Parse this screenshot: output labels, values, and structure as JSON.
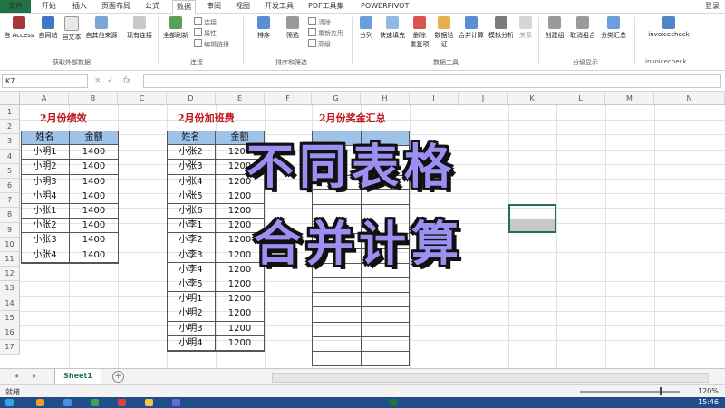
{
  "tabs": [
    "文件",
    "开始",
    "插入",
    "页面布局",
    "公式",
    "数据",
    "审阅",
    "视图",
    "开发工具",
    "PDF工具集",
    "POWERPIVOT"
  ],
  "active_tab": "数据",
  "login_label": "登录",
  "ribbon": {
    "external": {
      "access": "自 Access",
      "web": "自网站",
      "text": "自文本",
      "other": "自其他来源",
      "existing": "现有连接",
      "group": "获取外部数据"
    },
    "connections": {
      "refresh": "全部刷新",
      "conn": "连接",
      "props": "属性",
      "edit": "编辑链接",
      "group": "连接"
    },
    "sort": {
      "sort": "排序",
      "filter": "筛选",
      "clear": "清除",
      "reapply": "重新应用",
      "advanced": "高级",
      "group": "排序和筛选"
    },
    "tools": {
      "split": "分列",
      "flash": "快速填充",
      "dedupe_1": "删除",
      "dedupe_2": "重复项",
      "validate_1": "数据验",
      "validate_2": "证",
      "consolidate": "合并计算",
      "whatif": "模拟分析",
      "relations": "关系",
      "group": "数据工具"
    },
    "outline": {
      "group_btn": "创建组",
      "ungroup": "取消组合",
      "subtotal": "分类汇总",
      "group": "分级显示"
    },
    "invoice": {
      "btn": "invoicecheck",
      "group": "invoicecheck"
    }
  },
  "formula_bar": {
    "name_box": "K7",
    "cancel": "×",
    "enter": "✓",
    "fx": "fx",
    "value": ""
  },
  "columns": [
    "A",
    "B",
    "C",
    "D",
    "E",
    "F",
    "G",
    "H",
    "I",
    "J",
    "K",
    "L",
    "M",
    "N"
  ],
  "rows": [
    "1",
    "2",
    "3",
    "4",
    "5",
    "6",
    "7",
    "8",
    "9",
    "10",
    "11",
    "12",
    "13",
    "14",
    "15",
    "16",
    "17"
  ],
  "table1": {
    "title": "2月份绩效",
    "headers": [
      "姓名",
      "金额"
    ],
    "rows": [
      [
        "小明1",
        "1400"
      ],
      [
        "小明2",
        "1400"
      ],
      [
        "小明3",
        "1400"
      ],
      [
        "小明4",
        "1400"
      ],
      [
        "小张1",
        "1400"
      ],
      [
        "小张2",
        "1400"
      ],
      [
        "小张3",
        "1400"
      ],
      [
        "小张4",
        "1400"
      ]
    ]
  },
  "table2": {
    "title": "2月份加班费",
    "headers": [
      "姓名",
      "金额"
    ],
    "rows": [
      [
        "小张2",
        "1200"
      ],
      [
        "小张3",
        "1200"
      ],
      [
        "小张4",
        "1200"
      ],
      [
        "小张5",
        "1200"
      ],
      [
        "小张6",
        "1200"
      ],
      [
        "小李1",
        "1200"
      ],
      [
        "小李2",
        "1200"
      ],
      [
        "小李3",
        "1200"
      ],
      [
        "小李4",
        "1200"
      ],
      [
        "小李5",
        "1200"
      ],
      [
        "小明1",
        "1200"
      ],
      [
        "小明2",
        "1200"
      ],
      [
        "小明3",
        "1200"
      ],
      [
        "小明4",
        "1200"
      ]
    ]
  },
  "table3": {
    "title": "2月份奖金汇总"
  },
  "overlay": {
    "line1": "不同表格",
    "line2": "合并计算"
  },
  "sheet_tab": "Sheet1",
  "status": {
    "ready": "就绪",
    "zoom": "120%"
  },
  "clock": "15:46",
  "colors": {
    "excel_green": "#217346",
    "title_red": "#c0161d",
    "header_blue": "#9fc3e7",
    "overlay_purple": "#9b8ff2",
    "taskbar": "#1f4e8a"
  }
}
